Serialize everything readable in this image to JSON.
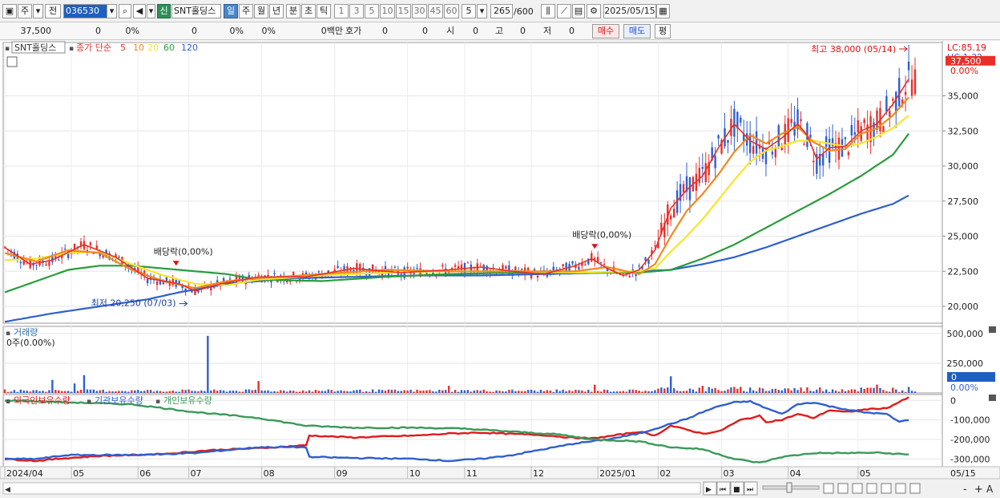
{
  "toolbar": {
    "period_label": "주",
    "prev_label": "전",
    "code": "036530",
    "new_label": "신",
    "stock_name": "SNT홀딩스",
    "period_tabs": [
      "일",
      "주",
      "월",
      "년",
      "분",
      "초",
      "틱"
    ],
    "active_tab": "일",
    "minute_options": [
      "1",
      "3",
      "5",
      "10",
      "15",
      "30",
      "45",
      "60"
    ],
    "minute_selected": "5",
    "count_value": "265",
    "count_total": "/600",
    "date_value": "2025/05/15"
  },
  "quote": {
    "price": "37,500",
    "change": "0",
    "change_pct": "0%",
    "volume": "0",
    "volume_pct": "0%",
    "turnover_pct": "0%",
    "amount": "0백만",
    "bid_label": "호가",
    "bid_a": "0",
    "bid_b": "0",
    "open_label": "시",
    "open_value": "0",
    "high_label": "고",
    "high_value": "0",
    "low_label": "저",
    "low_value": "0",
    "buy_label": "매수",
    "sell_label": "매도",
    "eval_label": "평"
  },
  "colors": {
    "up": "#e8302a",
    "down": "#2f5fd0",
    "ma5": "#e8302a",
    "ma10": "#f08a1f",
    "ma20": "#f5e62a",
    "ma60": "#2a9c3c",
    "ma120": "#2f5fd0",
    "foreign": "#e11a1a",
    "institution": "#2f5fd0",
    "individual": "#3a9a5a",
    "price_tag": "#e8302a"
  },
  "chart_data": [
    {
      "type": "candlestick",
      "title": "SNT홀딩스",
      "legend": {
        "ma_label": "종가 단순",
        "periods": [
          "5",
          "10",
          "20",
          "60",
          "120"
        ]
      },
      "y_ticks": [
        "35,000",
        "32,500",
        "30,000",
        "27,500",
        "25,000",
        "22,500",
        "20,000"
      ],
      "ylim": [
        18800,
        38800
      ],
      "x_labels": [
        "2024/04",
        "05",
        "06",
        "07",
        "08",
        "09",
        "10",
        "11",
        "12",
        "2025/01",
        "02",
        "03",
        "04",
        "05"
      ],
      "x_end_label": "05/15",
      "ma_lines": {
        "ma5": [
          [
            0,
            24200
          ],
          [
            8,
            23000
          ],
          [
            15,
            23300
          ],
          [
            25,
            24400
          ],
          [
            35,
            23500
          ],
          [
            45,
            22000
          ],
          [
            55,
            21600
          ],
          [
            60,
            21100
          ],
          [
            68,
            21600
          ],
          [
            80,
            22100
          ],
          [
            95,
            22100
          ],
          [
            110,
            22700
          ],
          [
            125,
            22400
          ],
          [
            140,
            22600
          ],
          [
            150,
            22800
          ],
          [
            160,
            22500
          ],
          [
            170,
            22300
          ],
          [
            180,
            22900
          ],
          [
            185,
            23400
          ],
          [
            190,
            22700
          ],
          [
            195,
            22200
          ],
          [
            200,
            22600
          ],
          [
            205,
            24000
          ],
          [
            210,
            27000
          ],
          [
            215,
            28300
          ],
          [
            220,
            29300
          ],
          [
            225,
            31300
          ],
          [
            230,
            33000
          ],
          [
            235,
            31800
          ],
          [
            240,
            31200
          ],
          [
            245,
            32000
          ],
          [
            250,
            33000
          ],
          [
            253,
            32200
          ],
          [
            256,
            30500
          ],
          [
            260,
            31300
          ],
          [
            265,
            31400
          ],
          [
            270,
            32500
          ],
          [
            275,
            33000
          ],
          [
            280,
            34400
          ],
          [
            285,
            36200
          ]
        ],
        "ma10": [
          [
            0,
            23800
          ],
          [
            10,
            23200
          ],
          [
            20,
            24000
          ],
          [
            30,
            23800
          ],
          [
            40,
            22600
          ],
          [
            50,
            21800
          ],
          [
            60,
            21300
          ],
          [
            70,
            21800
          ],
          [
            80,
            22000
          ],
          [
            100,
            22300
          ],
          [
            120,
            22600
          ],
          [
            140,
            22500
          ],
          [
            160,
            22500
          ],
          [
            180,
            22500
          ],
          [
            190,
            22800
          ],
          [
            200,
            22300
          ],
          [
            205,
            23000
          ],
          [
            210,
            25000
          ],
          [
            215,
            26800
          ],
          [
            220,
            28000
          ],
          [
            225,
            29400
          ],
          [
            230,
            31000
          ],
          [
            235,
            32200
          ],
          [
            240,
            31600
          ],
          [
            245,
            32300
          ],
          [
            250,
            32800
          ],
          [
            255,
            31700
          ],
          [
            260,
            31100
          ],
          [
            265,
            31200
          ],
          [
            270,
            32300
          ],
          [
            275,
            32700
          ],
          [
            280,
            33600
          ],
          [
            285,
            34900
          ]
        ],
        "ma20": [
          [
            0,
            23300
          ],
          [
            10,
            23400
          ],
          [
            20,
            23800
          ],
          [
            30,
            23900
          ],
          [
            40,
            23000
          ],
          [
            50,
            22200
          ],
          [
            60,
            21600
          ],
          [
            70,
            21500
          ],
          [
            80,
            21900
          ],
          [
            100,
            22200
          ],
          [
            120,
            22400
          ],
          [
            140,
            22500
          ],
          [
            160,
            22500
          ],
          [
            180,
            22400
          ],
          [
            200,
            22500
          ],
          [
            205,
            22700
          ],
          [
            210,
            23900
          ],
          [
            215,
            25000
          ],
          [
            220,
            26200
          ],
          [
            225,
            27600
          ],
          [
            230,
            29000
          ],
          [
            235,
            30300
          ],
          [
            240,
            31100
          ],
          [
            245,
            31400
          ],
          [
            250,
            31800
          ],
          [
            255,
            31800
          ],
          [
            260,
            31600
          ],
          [
            265,
            31400
          ],
          [
            270,
            31600
          ],
          [
            275,
            32100
          ],
          [
            280,
            32700
          ],
          [
            285,
            33600
          ]
        ],
        "ma60": [
          [
            0,
            21000
          ],
          [
            20,
            22600
          ],
          [
            30,
            22900
          ],
          [
            40,
            22900
          ],
          [
            55,
            22600
          ],
          [
            70,
            22300
          ],
          [
            80,
            21900
          ],
          [
            100,
            21800
          ],
          [
            120,
            22100
          ],
          [
            140,
            22300
          ],
          [
            160,
            22400
          ],
          [
            180,
            22400
          ],
          [
            200,
            22400
          ],
          [
            210,
            22600
          ],
          [
            220,
            23400
          ],
          [
            230,
            24400
          ],
          [
            240,
            25600
          ],
          [
            250,
            26800
          ],
          [
            260,
            28000
          ],
          [
            270,
            29300
          ],
          [
            280,
            30800
          ],
          [
            285,
            32300
          ]
        ],
        "ma120": [
          [
            0,
            18900
          ],
          [
            15,
            19500
          ],
          [
            30,
            20000
          ],
          [
            45,
            20500
          ],
          [
            55,
            21000
          ],
          [
            70,
            21600
          ],
          [
            90,
            22000
          ],
          [
            110,
            22100
          ],
          [
            130,
            22200
          ],
          [
            150,
            22200
          ],
          [
            170,
            22300
          ],
          [
            190,
            22400
          ],
          [
            210,
            22600
          ],
          [
            220,
            23000
          ],
          [
            230,
            23500
          ],
          [
            240,
            24200
          ],
          [
            250,
            25000
          ],
          [
            260,
            25800
          ],
          [
            270,
            26600
          ],
          [
            280,
            27300
          ],
          [
            285,
            27900
          ]
        ]
      },
      "annotations": [
        {
          "text": "최고 38,000 (05/14)",
          "x": 284,
          "y": 38000
        },
        {
          "text": "최저 20,250 (07/03)",
          "x": 57,
          "y": 20250
        },
        {
          "text": "배당락(0,00%)",
          "x": 54,
          "y": 22900
        },
        {
          "text": "배당락(0,00%)",
          "x": 186,
          "y": 24100
        }
      ],
      "right_labels": {
        "lc": "LC:85.19",
        "hc": "HC:1.32",
        "price_tag": "37,500",
        "pct": "0.00%"
      }
    },
    {
      "type": "bar",
      "title": "거래량",
      "value_label": "0주(0.00%)",
      "y_ticks": [
        "500,000",
        "250,000"
      ],
      "ylim": [
        0,
        560000
      ],
      "current_tag": "0",
      "current_pct": "0.00%",
      "peaks": [
        [
          64,
          480000
        ],
        [
          15,
          110000
        ],
        [
          25,
          150000
        ],
        [
          80,
          100000
        ],
        [
          210,
          140000
        ],
        [
          22,
          80000
        ],
        [
          140,
          60000
        ],
        [
          186,
          70000
        ],
        [
          220,
          60000
        ],
        [
          275,
          70000
        ]
      ]
    },
    {
      "type": "line",
      "title": "외국인보유수량",
      "series": [
        {
          "name": "외국인보유수량",
          "color_key": "foreign",
          "points": [
            [
              0,
              -300000
            ],
            [
              10,
              -310000
            ],
            [
              20,
              -295000
            ],
            [
              30,
              -285000
            ],
            [
              50,
              -275000
            ],
            [
              65,
              -255000
            ],
            [
              80,
              -245000
            ],
            [
              95,
              -230000
            ],
            [
              96,
              -180000
            ],
            [
              110,
              -190000
            ],
            [
              130,
              -180000
            ],
            [
              140,
              -170000
            ],
            [
              150,
              -165000
            ],
            [
              160,
              -172000
            ],
            [
              170,
              -178000
            ],
            [
              178,
              -190000
            ],
            [
              185,
              -195000
            ],
            [
              190,
              -185000
            ],
            [
              200,
              -160000
            ],
            [
              205,
              -180000
            ],
            [
              210,
              -130000
            ],
            [
              215,
              -150000
            ],
            [
              220,
              -170000
            ],
            [
              225,
              -160000
            ],
            [
              232,
              -100000
            ],
            [
              238,
              -80000
            ],
            [
              240,
              -110000
            ],
            [
              245,
              -100000
            ],
            [
              250,
              -70000
            ],
            [
              255,
              -90000
            ],
            [
              260,
              -50000
            ],
            [
              265,
              -60000
            ],
            [
              272,
              -45000
            ],
            [
              278,
              -40000
            ],
            [
              285,
              15000
            ]
          ]
        },
        {
          "name": "기관보유수량",
          "color_key": "institution",
          "points": [
            [
              0,
              -300000
            ],
            [
              10,
              -300000
            ],
            [
              20,
              -280000
            ],
            [
              40,
              -280000
            ],
            [
              60,
              -270000
            ],
            [
              80,
              -240000
            ],
            [
              95,
              -240000
            ],
            [
              96,
              -290000
            ],
            [
              110,
              -295000
            ],
            [
              130,
              -300000
            ],
            [
              140,
              -310000
            ],
            [
              150,
              -300000
            ],
            [
              160,
              -280000
            ],
            [
              170,
              -250000
            ],
            [
              180,
              -220000
            ],
            [
              190,
              -200000
            ],
            [
              200,
              -170000
            ],
            [
              210,
              -120000
            ],
            [
              215,
              -95000
            ],
            [
              220,
              -60000
            ],
            [
              225,
              -30000
            ],
            [
              230,
              -10000
            ],
            [
              235,
              -5000
            ],
            [
              240,
              -40000
            ],
            [
              245,
              -70000
            ],
            [
              250,
              -20000
            ],
            [
              255,
              -10000
            ],
            [
              260,
              -30000
            ],
            [
              270,
              -60000
            ],
            [
              278,
              -70000
            ],
            [
              282,
              -110000
            ],
            [
              285,
              -100000
            ]
          ]
        },
        {
          "name": "개인보유수량",
          "color_key": "individual",
          "points": [
            [
              0,
              0
            ],
            [
              20,
              -10000
            ],
            [
              40,
              -20000
            ],
            [
              60,
              -60000
            ],
            [
              80,
              -90000
            ],
            [
              95,
              -130000
            ],
            [
              110,
              -140000
            ],
            [
              130,
              -140000
            ],
            [
              145,
              -145000
            ],
            [
              160,
              -160000
            ],
            [
              175,
              -175000
            ],
            [
              185,
              -200000
            ],
            [
              200,
              -210000
            ],
            [
              210,
              -240000
            ],
            [
              220,
              -250000
            ],
            [
              230,
              -300000
            ],
            [
              238,
              -320000
            ],
            [
              245,
              -290000
            ],
            [
              255,
              -270000
            ],
            [
              265,
              -270000
            ],
            [
              275,
              -268000
            ],
            [
              285,
              -278000
            ]
          ]
        }
      ],
      "y_ticks": [
        "0",
        "-100,000",
        "-200,000",
        "-300,000"
      ],
      "ylim": [
        -340000,
        30000
      ]
    }
  ],
  "bottombar": {
    "zoom_labels": [
      "-",
      "+",
      "A"
    ]
  }
}
